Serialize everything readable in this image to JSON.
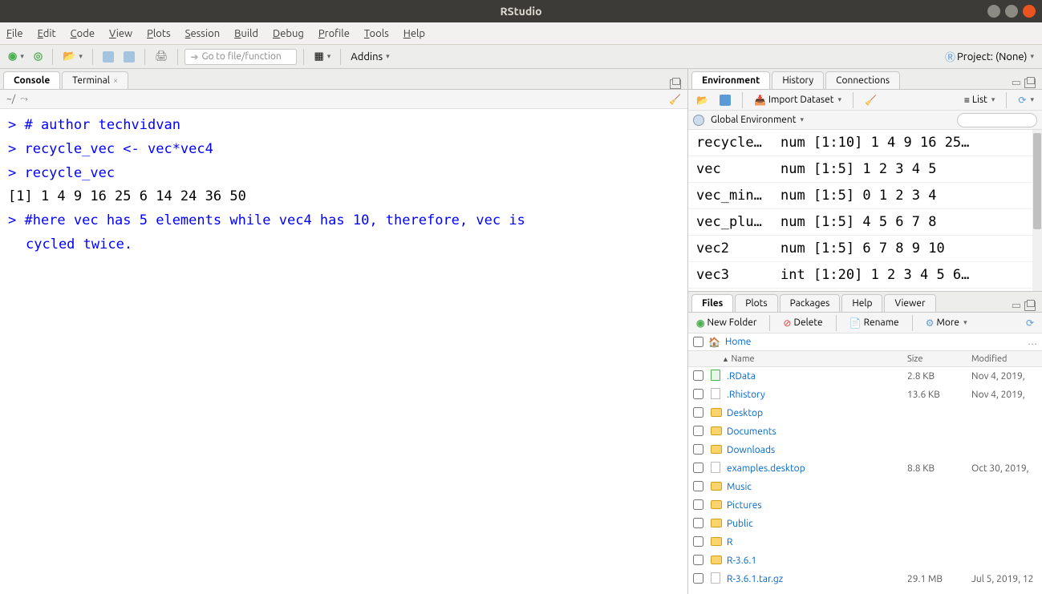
{
  "window": {
    "title": "RStudio"
  },
  "menu": {
    "file": "File",
    "edit": "Edit",
    "code": "Code",
    "view": "View",
    "plots": "Plots",
    "session": "Session",
    "build": "Build",
    "debug": "Debug",
    "profile": "Profile",
    "tools": "Tools",
    "help": "Help"
  },
  "toolbar": {
    "goto_placeholder": "Go to file/function",
    "addins": "Addins",
    "project_label": "Project: (None)"
  },
  "left": {
    "tabs": {
      "console": "Console",
      "terminal": "Terminal"
    },
    "path": "~/",
    "console_lines": [
      {
        "type": "prompt",
        "text": "> # author techvidvan"
      },
      {
        "type": "prompt",
        "text": "> recycle_vec <- vec*vec4"
      },
      {
        "type": "prompt",
        "text": "> recycle_vec"
      },
      {
        "type": "output",
        "text": " [1]  1  4  9 16 25  6 14 24 36 50"
      },
      {
        "type": "prompt",
        "text": "> #here vec has 5 elements while vec4 has 10, therefore, vec is "
      },
      {
        "type": "prompt-cont",
        "text": "cycled twice."
      }
    ]
  },
  "env": {
    "tabs": {
      "env": "Environment",
      "history": "History",
      "conn": "Connections"
    },
    "import": "Import Dataset",
    "list": "List",
    "scope": "Global Environment",
    "vars": [
      {
        "name": "recycle…",
        "value": "num [1:10] 1 4 9 16 25…"
      },
      {
        "name": "vec",
        "value": "num [1:5] 1 2 3 4 5"
      },
      {
        "name": "vec_min…",
        "value": "num [1:5] 0 1 2 3 4"
      },
      {
        "name": "vec_plu…",
        "value": "num [1:5] 4 5 6 7 8"
      },
      {
        "name": "vec2",
        "value": "num [1:5] 6 7 8 9 10"
      },
      {
        "name": "vec3",
        "value": "int [1:20] 1 2 3 4 5 6…"
      }
    ]
  },
  "files": {
    "tabs": {
      "files": "Files",
      "plots": "Plots",
      "pkg": "Packages",
      "help": "Help",
      "viewer": "Viewer"
    },
    "newfolder": "New Folder",
    "delete": "Delete",
    "rename": "Rename",
    "more": "More",
    "path": "Home",
    "headers": {
      "name": "Name",
      "size": "Size",
      "mod": "Modified"
    },
    "rows": [
      {
        "icon": "rdata",
        "name": ".RData",
        "size": "2.8 KB",
        "mod": "Nov 4, 2019,"
      },
      {
        "icon": "file",
        "name": ".Rhistory",
        "size": "13.6 KB",
        "mod": "Nov 4, 2019,"
      },
      {
        "icon": "folder",
        "name": "Desktop",
        "size": "",
        "mod": ""
      },
      {
        "icon": "folder",
        "name": "Documents",
        "size": "",
        "mod": ""
      },
      {
        "icon": "folder",
        "name": "Downloads",
        "size": "",
        "mod": ""
      },
      {
        "icon": "file",
        "name": "examples.desktop",
        "size": "8.8 KB",
        "mod": "Oct 30, 2019,"
      },
      {
        "icon": "folder",
        "name": "Music",
        "size": "",
        "mod": ""
      },
      {
        "icon": "folder",
        "name": "Pictures",
        "size": "",
        "mod": ""
      },
      {
        "icon": "folder-lock",
        "name": "Public",
        "size": "",
        "mod": ""
      },
      {
        "icon": "folder",
        "name": "R",
        "size": "",
        "mod": ""
      },
      {
        "icon": "folder",
        "name": "R-3.6.1",
        "size": "",
        "mod": ""
      },
      {
        "icon": "file",
        "name": "R-3.6.1.tar.gz",
        "size": "29.1 MB",
        "mod": "Jul 5, 2019, 12"
      }
    ]
  }
}
